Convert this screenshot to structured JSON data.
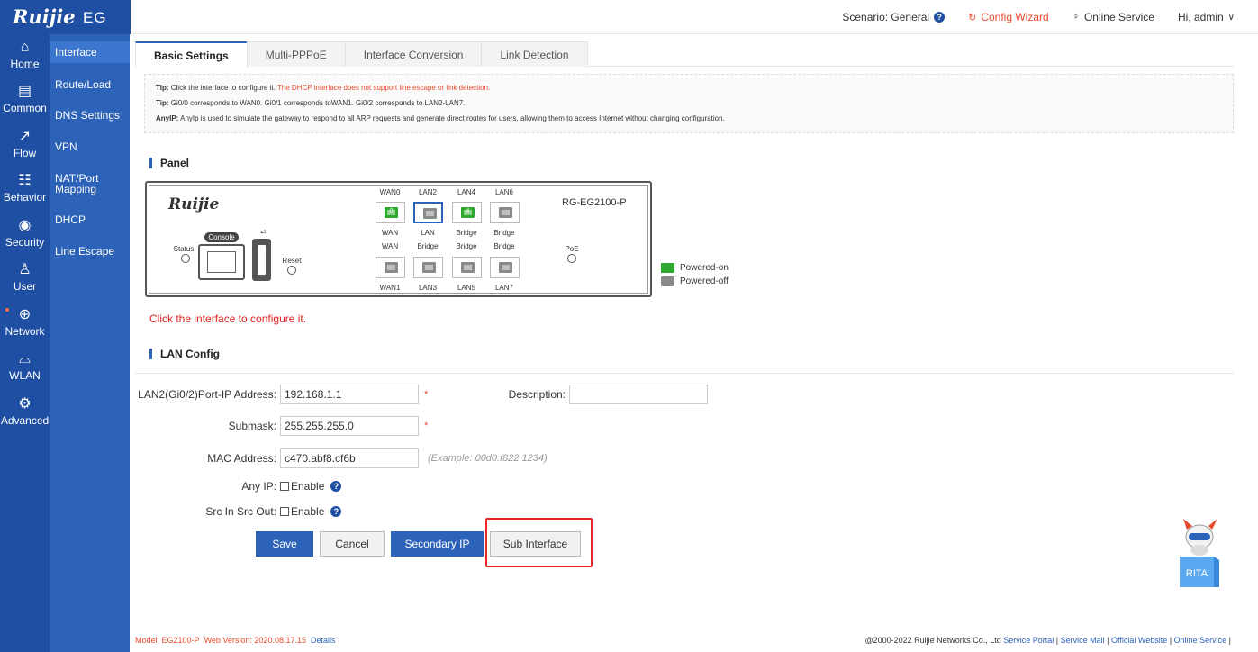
{
  "header": {
    "logo": "Ruijie",
    "product": "EG",
    "scenario_label": "Scenario: General",
    "config_wizard": "Config Wizard",
    "online_service": "Online Service",
    "user_greeting": "Hi, admin"
  },
  "leftnav": [
    {
      "label": "Home",
      "icon": "home-icon"
    },
    {
      "label": "Common",
      "icon": "briefcase-icon"
    },
    {
      "label": "Flow",
      "icon": "chart-icon"
    },
    {
      "label": "Behavior",
      "icon": "behavior-icon"
    },
    {
      "label": "Security",
      "icon": "shield-icon"
    },
    {
      "label": "User",
      "icon": "user-icon"
    },
    {
      "label": "Network",
      "icon": "globe-icon"
    },
    {
      "label": "WLAN",
      "icon": "wifi-icon"
    },
    {
      "label": "Advanced",
      "icon": "gear-icon"
    }
  ],
  "subnav": [
    {
      "label": "Interface"
    },
    {
      "label": "Route/Load"
    },
    {
      "label": "DNS Settings"
    },
    {
      "label": "VPN"
    },
    {
      "label": "NAT/Port Mapping"
    },
    {
      "label": "DHCP"
    },
    {
      "label": "Line Escape"
    }
  ],
  "tabs": [
    {
      "label": "Basic Settings"
    },
    {
      "label": "Multi-PPPoE"
    },
    {
      "label": "Interface Conversion"
    },
    {
      "label": "Link Detection"
    }
  ],
  "tips": {
    "tip1_label": "Tip:",
    "tip1_text": " Click the interface to configure it. ",
    "tip1_red": "The DHCP interface does not support line escape or link detection.",
    "tip2_label": "Tip:",
    "tip2_text": " Gi0/0 corresponds to WAN0. Gi0/1 corresponds toWAN1. Gi0/2 corresponds to LAN2-LAN7.",
    "tip3_label": "AnyIP:",
    "tip3_text": " AnyIp is used to simulate the gateway to respond to all ARP requests and generate direct routes for users, allowing them to access Internet without changing configuration."
  },
  "panel": {
    "title": "Panel",
    "logo": "Ruijie",
    "model": "RG-EG2100-P",
    "console": "Console",
    "status": "Status",
    "reset": "Reset",
    "poe": "PoE",
    "top_ports": [
      {
        "name": "WAN0",
        "mode": "WAN",
        "num": "0",
        "state": "on"
      },
      {
        "name": "LAN2",
        "mode": "LAN",
        "num": "",
        "state": "off"
      },
      {
        "name": "LAN4",
        "mode": "Bridge",
        "num": "4",
        "state": "on"
      },
      {
        "name": "LAN6",
        "mode": "Bridge",
        "num": "",
        "state": "off"
      }
    ],
    "bottom_ports": [
      {
        "name": "WAN1",
        "mode": "WAN"
      },
      {
        "name": "LAN3",
        "mode": "Bridge"
      },
      {
        "name": "LAN5",
        "mode": "Bridge"
      },
      {
        "name": "LAN7",
        "mode": "Bridge"
      }
    ],
    "top_mode_row": [
      "WAN",
      "LAN",
      "Bridge",
      "Bridge"
    ],
    "legend_on": "Powered-on",
    "legend_off": "Powered-off",
    "color_on": "#2ea82e",
    "color_off": "#8a8a8a"
  },
  "click_hint": "Click the interface to configure it.",
  "lan_config": {
    "title": "LAN Config",
    "ip_label": "LAN2(Gi0/2)Port-IP Address:",
    "ip_value": "192.168.1.1",
    "desc_label": "Description:",
    "desc_value": "",
    "submask_label": "Submask:",
    "submask_value": "255.255.255.0",
    "mac_label": "MAC Address:",
    "mac_value": "c470.abf8.cf6b",
    "mac_example": "(Example: 00d0.f822.1234)",
    "anyip_label": "Any IP:",
    "anyip_enable": "Enable",
    "srcin_label": "Src In Src Out:",
    "srcin_enable": "Enable",
    "required": "*"
  },
  "buttons": {
    "save": "Save",
    "cancel": "Cancel",
    "secondary_ip": "Secondary IP",
    "sub_interface": "Sub Interface"
  },
  "footer": {
    "model": "Model: EG2100-P",
    "web_version": "Web Version: 2020.08.17.15",
    "details": "Details",
    "copyright": "@2000-2022 Ruijie Networks Co., Ltd",
    "service_portal": "Service Portal",
    "service_mail": "Service Mail",
    "official_website": "Official Website",
    "online_service": "Online Service",
    "sep": "|"
  },
  "rita": "RITA",
  "colors": {
    "nav_bg": "#1f4fa3",
    "subnav_bg": "#2c62b8",
    "accent_red": "#e84a2f",
    "primary": "#2c62b8"
  }
}
